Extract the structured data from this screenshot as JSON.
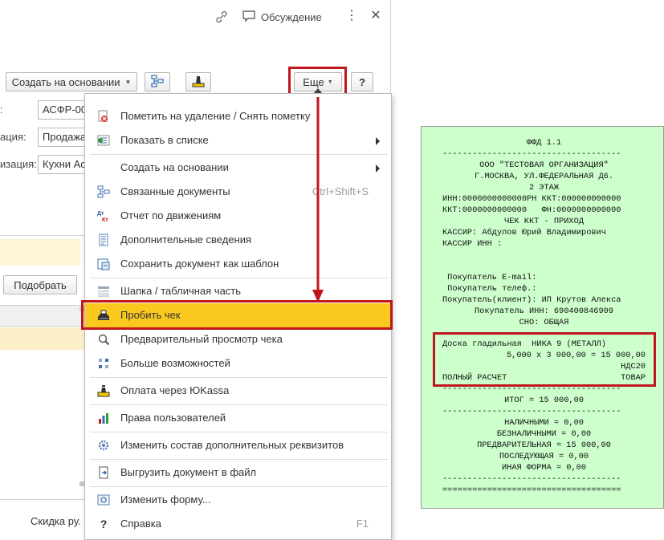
{
  "titlebar": {
    "discuss_label": "Обсуждение",
    "menu_glyph": "⋮",
    "close_glyph": "✕"
  },
  "toolbar": {
    "create_based_label": "Создать на основании",
    "more_label": "Еще",
    "help_label": "?"
  },
  "form": {
    "field1_label": ":",
    "field1_value": "АСФР-00",
    "field2_label": "ация:",
    "field2_value": "Продажа",
    "field3_label": "изация:",
    "field3_value": "Кухни Ас"
  },
  "tabular": {
    "pick_label": "Подобрать",
    "row_marker": "5",
    "discount_label": "Скидка ру."
  },
  "menu": {
    "items": [
      {
        "label": "Пометить на удаление / Снять пометку",
        "icon": "delete-mark-icon"
      },
      {
        "label": "Показать в списке",
        "icon": "show-in-list-icon",
        "submenu": true
      },
      {
        "label": "Создать на основании",
        "icon": "",
        "submenu": true
      },
      {
        "label": "Связанные документы",
        "icon": "linked-docs-icon",
        "shortcut": "Ctrl+Shift+S"
      },
      {
        "label": "Отчет по движениям",
        "icon": "debit-credit-icon"
      },
      {
        "label": "Дополнительные сведения",
        "icon": "additional-info-icon"
      },
      {
        "label": "Сохранить документ как шаблон",
        "icon": "save-template-icon"
      },
      {
        "label": "Шапка / табличная часть",
        "icon": "header-table-icon"
      },
      {
        "label": "Пробить чек",
        "icon": "cash-register-icon"
      },
      {
        "label": "Предварительный просмотр чека",
        "icon": "preview-icon"
      },
      {
        "label": "Больше возможностей",
        "icon": "more-features-icon"
      },
      {
        "label": "Оплата через ЮKassa",
        "icon": "kassa-icon"
      },
      {
        "label": "Права пользователей",
        "icon": "user-rights-icon"
      },
      {
        "label": "Изменить состав дополнительных реквизитов",
        "icon": "gear-icon"
      },
      {
        "label": "Выгрузить документ в файл",
        "icon": "export-file-icon"
      },
      {
        "label": "Изменить форму...",
        "icon": "edit-form-icon"
      },
      {
        "label": "Справка",
        "icon": "help-icon",
        "shortcut": "F1"
      }
    ],
    "active_item": "Пробить чек",
    "active_color": "#f9c91f"
  },
  "receipt": {
    "background": "#ccffcc",
    "highlight_color": "#c0161c",
    "ffd": "ФФД 1.1",
    "dash_line": "------------------------------------",
    "double_line": "====================================",
    "org_name": "ООО \"ТЕСТОВАЯ ОРГАНИЗАЦИЯ\"",
    "address1": "Г.МОСКВА, УЛ.ФЕДЕРАЛЬНАЯ Д6.",
    "address2": "2 ЭТАЖ",
    "inn_kkt": "ИНН:0000000000000РН ККТ:000000000000",
    "kkt_fn": "ККТ:0000000000000   ФН:0000000000000",
    "check_type": "ЧЕК ККТ - ПРИХОД",
    "cashier": "КАССИР: Абдулов Юрий Владимирович",
    "cashier_inn": "КАССИР ИНН :",
    "buyer_email": " Покупатель E-mail:",
    "buyer_phone": " Покупатель телеф.:",
    "buyer_client": "Покупатель(клиент): ИП Крутов Алекса",
    "buyer_inn": "Покупатель ИНН: 690400846909",
    "sno": "СНО: ОБЩАЯ",
    "item_name": "Доска гладильная  НИКА 9 (МЕТАЛЛ)",
    "item_calc": "5,000 x 3 000,00 = 15 000,00",
    "item_vat": "НДС20",
    "item_payment_mode": "ПОЛНЫЙ РАСЧЕТ",
    "item_subject": "ТОВАР",
    "total": "ИТОГ = 15 000,00",
    "cash": "НАЛИЧНЫМИ = 0,00",
    "cashless": "БЕЗНАЛИЧНЫМИ = 0,00",
    "prepaid": "ПРЕДВАРИТЕЛЬНАЯ = 15 000,00",
    "postpaid": "ПОСЛЕДУЮЩАЯ = 0,00",
    "other_form": "ИНАЯ ФОРМА = 0,00"
  }
}
